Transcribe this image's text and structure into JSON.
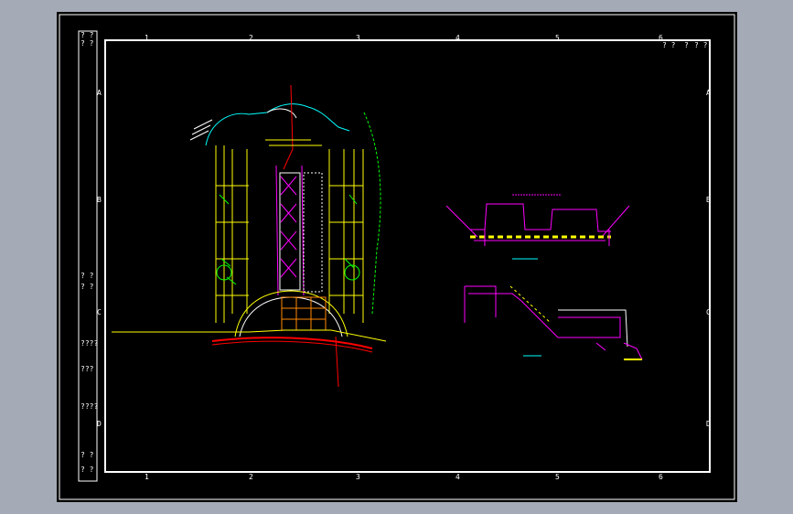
{
  "grid": {
    "columns": [
      "1",
      "2",
      "3",
      "4",
      "5",
      "6"
    ],
    "rows": [
      "A",
      "B",
      "C",
      "D"
    ]
  },
  "title_block": {
    "top_left_cells": [
      "? ?",
      "? ?"
    ],
    "top_right_cells": [
      "? ?",
      "?",
      "? ?"
    ],
    "left_side_cells": [
      "? ?",
      "? ?",
      "????",
      "???",
      "????",
      "? ?",
      "? ?"
    ]
  },
  "colors": {
    "background": "#000000",
    "frame": "#ffffff",
    "walls": "#ffff00",
    "greenery": "#00ff00",
    "axis": "#ff00ff",
    "annotation": "#ff0000",
    "site_edge": "#00ffff"
  }
}
